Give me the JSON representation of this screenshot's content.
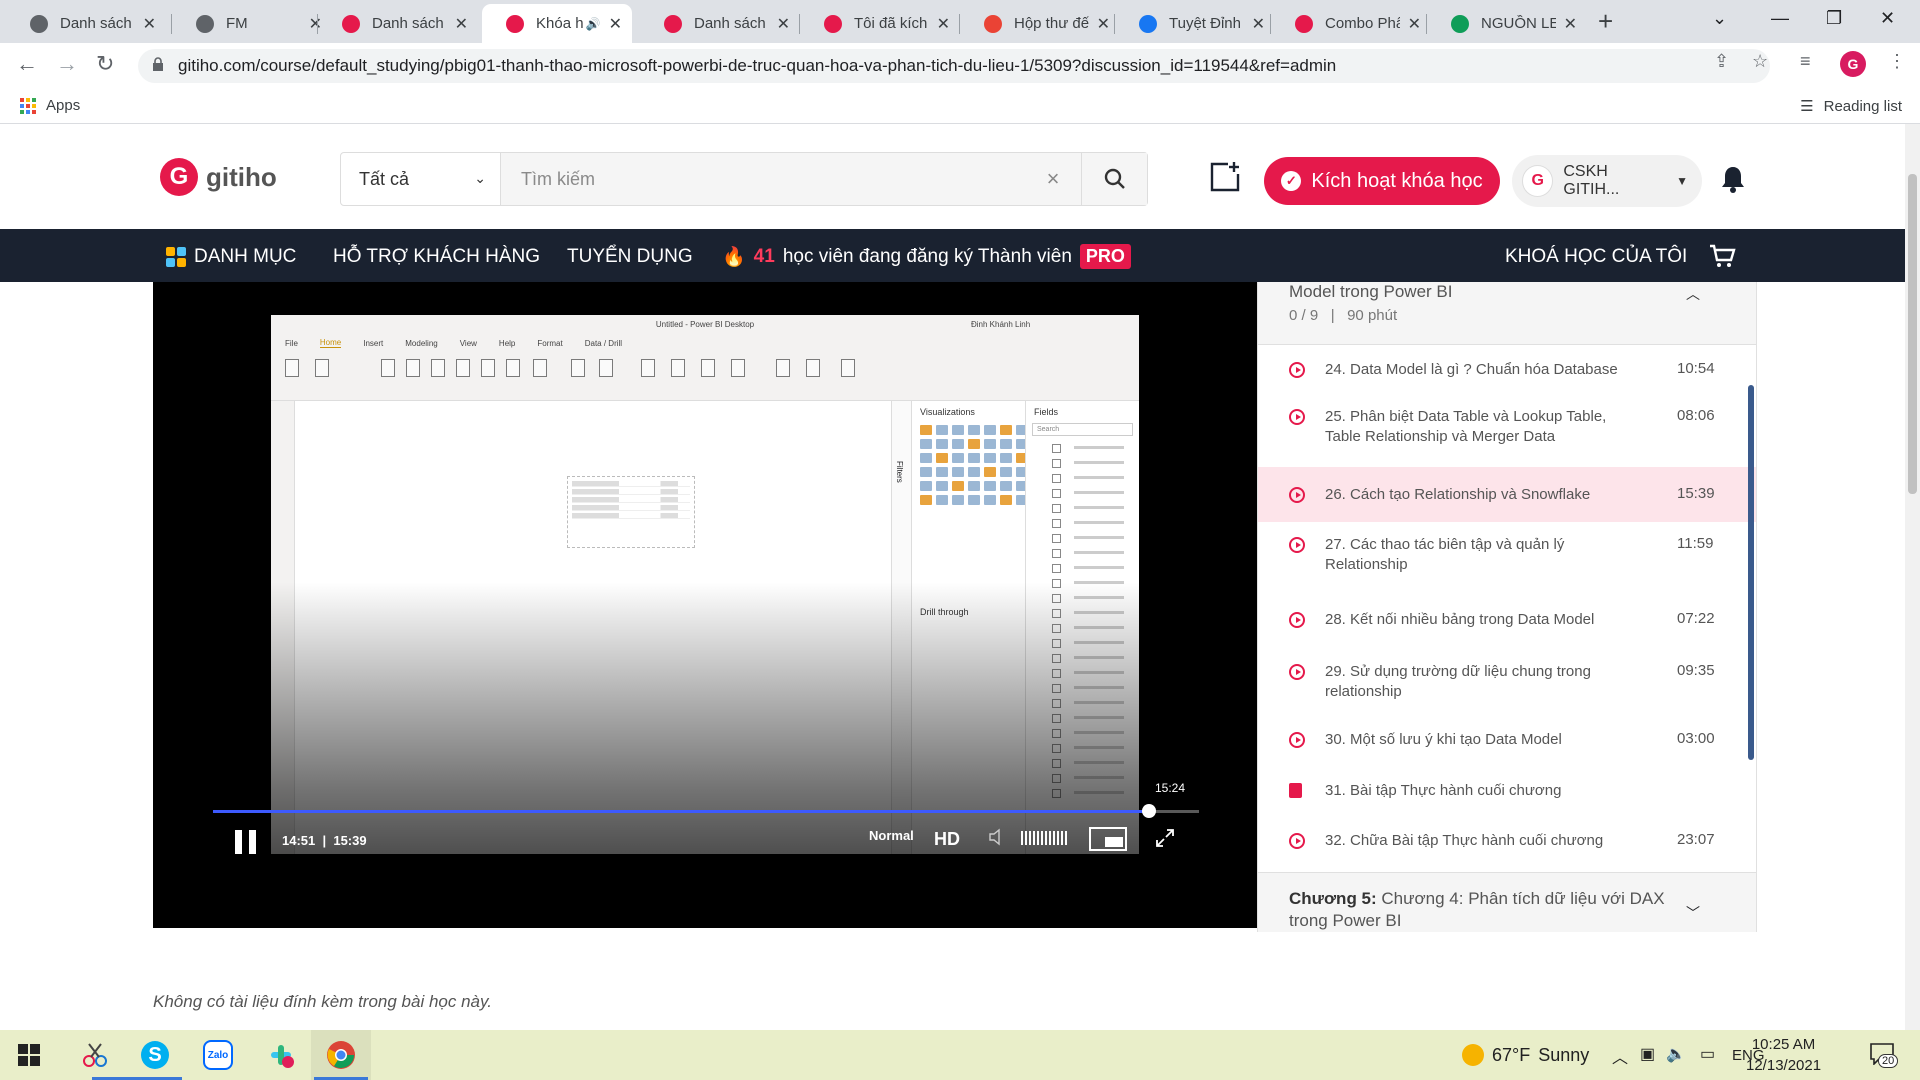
{
  "browser": {
    "tabs": [
      {
        "label": "Danh sách l",
        "favicon": "globe-icon",
        "color": "#5f6368"
      },
      {
        "label": "FM",
        "favicon": "globe-icon",
        "color": "#5f6368"
      },
      {
        "label": "Danh sách t",
        "favicon": "gitiho-icon",
        "color": "#e5194b"
      },
      {
        "label": "Khóa h",
        "favicon": "gitiho-icon",
        "color": "#e5194b",
        "active": true
      },
      {
        "label": "Danh sách l",
        "favicon": "gitiho-icon",
        "color": "#e5194b"
      },
      {
        "label": "Tôi đã kích",
        "favicon": "gitiho-icon",
        "color": "#e5194b"
      },
      {
        "label": "Hộp thư đế",
        "favicon": "gmail-icon",
        "color": "#ea4335"
      },
      {
        "label": "Tuyệt Đỉnh",
        "favicon": "facebook-icon",
        "color": "#1877f2"
      },
      {
        "label": "Combo Phâ",
        "favicon": "gitiho-icon",
        "color": "#e5194b"
      },
      {
        "label": "NGUỒN LE",
        "favicon": "sheets-icon",
        "color": "#0f9d58"
      }
    ],
    "url": "gitiho.com/course/default_studying/pbig01-thanh-thao-microsoft-powerbi-de-truc-quan-hoa-va-phan-tich-du-lieu-1/5309?discussion_id=119544&ref=admin",
    "bookmarks": {
      "apps_label": "Apps",
      "reading_list_label": "Reading list"
    }
  },
  "header": {
    "logo_text": "gitiho",
    "search_category": "Tất cả",
    "search_placeholder": "Tìm kiếm",
    "activate_label": "Kích hoạt khóa học",
    "account_name": "CSKH GITIH...",
    "account_avatar_text": "gitiho"
  },
  "nav": {
    "categories": "DANH MỤC",
    "support": "HỖ TRỢ KHÁCH HÀNG",
    "careers": "TUYỂN DỤNG",
    "promo_count": "41",
    "promo_text": "học viên đang đăng ký Thành viên",
    "promo_badge": "PRO",
    "my_courses": "KHOÁ HỌC CỦA TÔI"
  },
  "video": {
    "app_title": "Untitled - Power BI Desktop",
    "app_user": "Đinh Khánh Linh",
    "menu": [
      "File",
      "Home",
      "Insert",
      "Modeling",
      "View",
      "Help",
      "Format",
      "Data / Drill"
    ],
    "visualizations_label": "Visualizations",
    "fields_label": "Fields",
    "search_label": "Search",
    "drill_through_label": "Drill through",
    "filters_label": "Filters",
    "current_time": "14:51",
    "duration": "15:39",
    "hover_time": "15:24",
    "progress_fraction": 0.949,
    "speed": "Normal",
    "quality": "HD"
  },
  "sidebar": {
    "chapter_title": "Model trong Power BI",
    "chapter_progress": "0 / 9",
    "chapter_duration": "90 phút",
    "lessons": [
      {
        "title": "24. Data Model là gì ? Chuẩn hóa Database",
        "duration": "10:54",
        "type": "video"
      },
      {
        "title": "25. Phân biệt Data Table và Lookup Table, Table Relationship và Merger Data",
        "duration": "08:06",
        "type": "video"
      },
      {
        "title": "26. Cách tạo Relationship và Snowflake",
        "duration": "15:39",
        "type": "video",
        "active": true
      },
      {
        "title": "27. Các thao tác biên tập và quản lý Relationship",
        "duration": "11:59",
        "type": "video"
      },
      {
        "title": "28. Kết nối nhiều bảng trong Data Model",
        "duration": "07:22",
        "type": "video"
      },
      {
        "title": "29. Sử dụng trường dữ liệu chung trong relationship",
        "duration": "09:35",
        "type": "video"
      },
      {
        "title": "30. Một số lưu ý khi tạo Data Model",
        "duration": "03:00",
        "type": "video"
      },
      {
        "title": "31. Bài tập Thực hành cuối chương",
        "duration": "",
        "type": "exercise"
      },
      {
        "title": "32. Chữa Bài tập Thực hành cuối chương",
        "duration": "23:07",
        "type": "video"
      }
    ],
    "next_chapter_prefix": "Chương 5:",
    "next_chapter_title": "Chương 4: Phân tích dữ liệu với DAX trong Power BI"
  },
  "no_attachment_text": "Không có tài liệu đính kèm trong bài học này.",
  "taskbar": {
    "temperature": "67°F",
    "weather": "Sunny",
    "language": "ENG",
    "time": "10:25 AM",
    "date": "12/13/2021",
    "notifications": "20"
  },
  "colors": {
    "brand": "#e5194b",
    "nav_bg": "#1a2230",
    "active_lesson_bg": "#fde4ea",
    "progress": "#3d5afe"
  }
}
